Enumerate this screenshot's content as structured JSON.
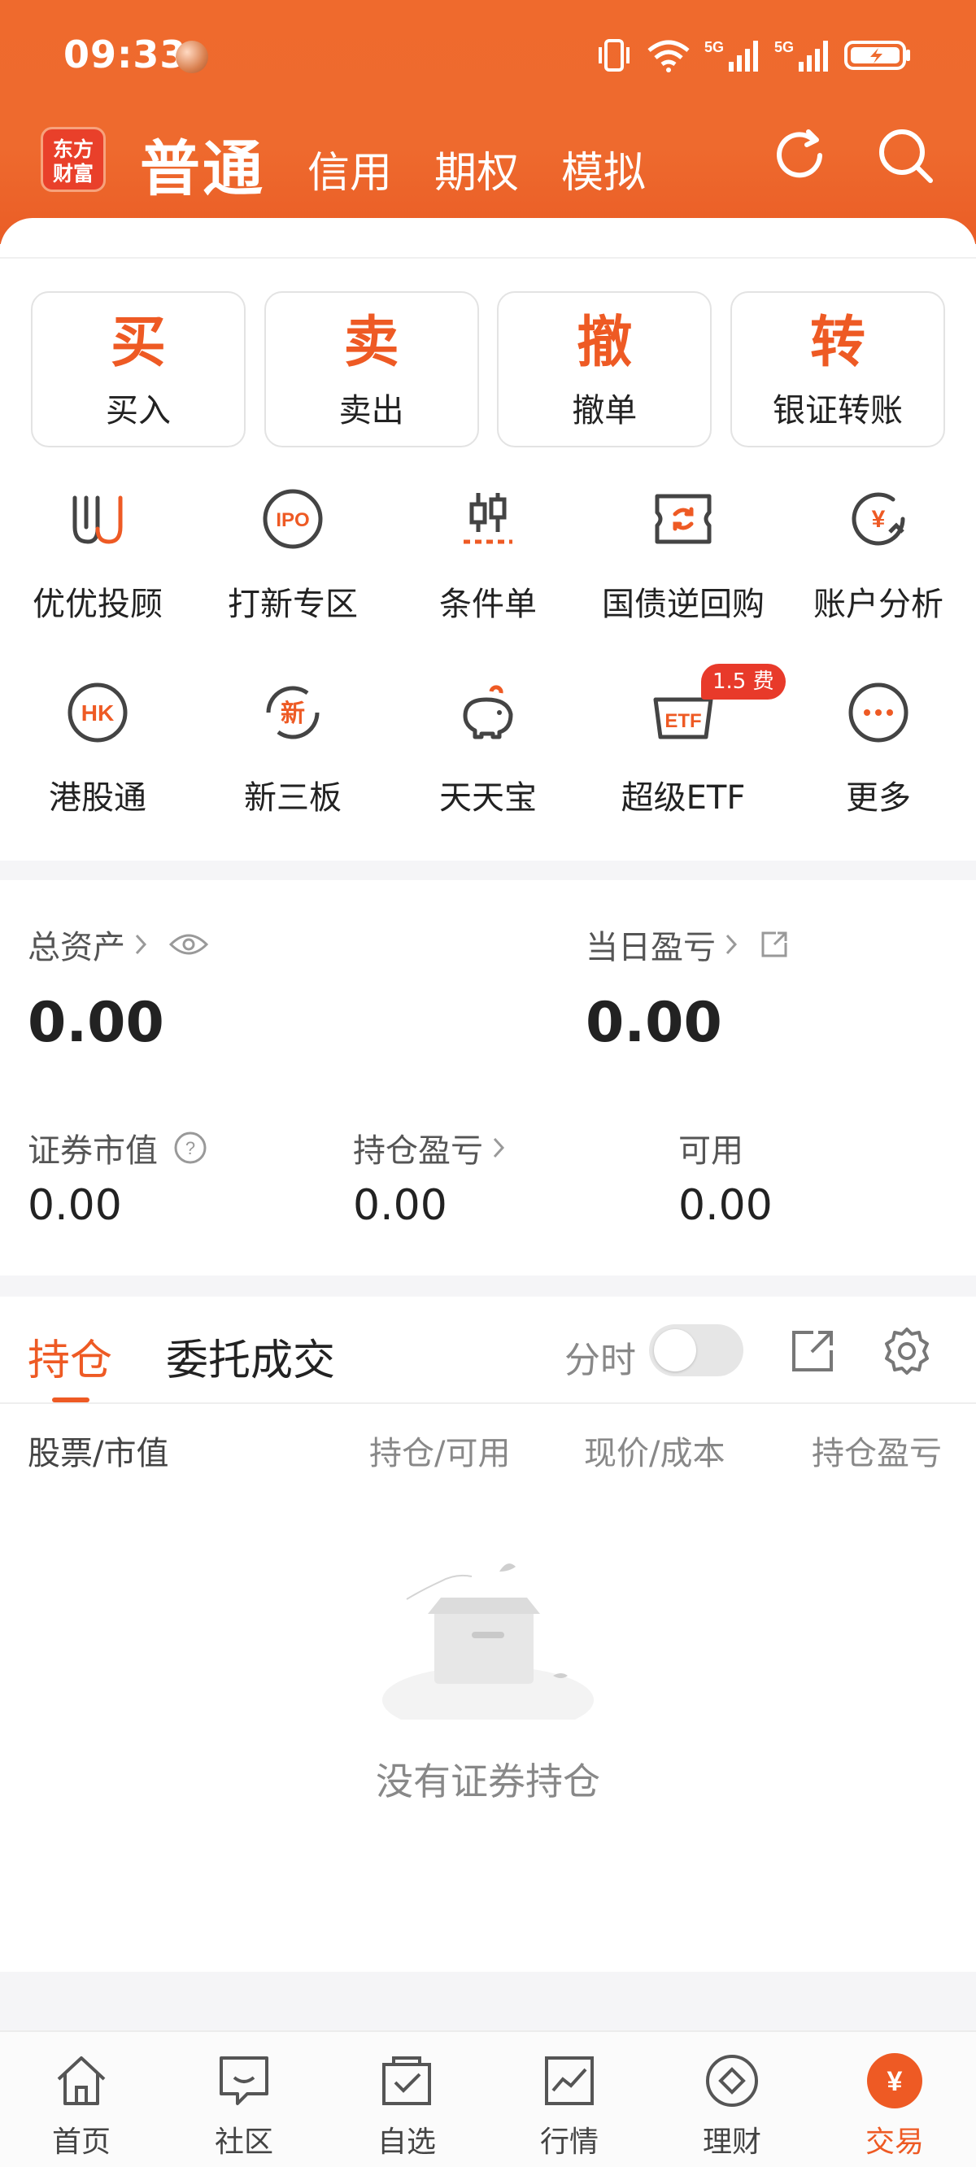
{
  "status_bar": {
    "time": "09:33",
    "network": "5G"
  },
  "header": {
    "logo_text": "东方\n财富",
    "logo_line1": "东方",
    "logo_line2": "财富",
    "tabs": [
      {
        "label": "普通",
        "active": true
      },
      {
        "label": "信用",
        "active": false
      },
      {
        "label": "期权",
        "active": false
      },
      {
        "label": "模拟",
        "active": false
      }
    ],
    "icons": [
      "refresh-icon",
      "search-icon"
    ]
  },
  "actions": [
    {
      "big": "买",
      "label": "买入"
    },
    {
      "big": "卖",
      "label": "卖出"
    },
    {
      "big": "撤",
      "label": "撤单"
    },
    {
      "big": "转",
      "label": "银证转账"
    }
  ],
  "grid": [
    {
      "label": "优优投顾",
      "icon": "advisor-icon"
    },
    {
      "label": "打新专区",
      "icon": "ipo-icon",
      "icon_text": "IPO"
    },
    {
      "label": "条件单",
      "icon": "condition-order-icon"
    },
    {
      "label": "国债逆回购",
      "icon": "reverse-repo-icon"
    },
    {
      "label": "账户分析",
      "icon": "account-analysis-icon",
      "icon_text": "¥"
    },
    {
      "label": "港股通",
      "icon": "hk-connect-icon",
      "icon_text": "HK"
    },
    {
      "label": "新三板",
      "icon": "new-third-board-icon",
      "icon_text": "新"
    },
    {
      "label": "天天宝",
      "icon": "piggy-bank-icon"
    },
    {
      "label": "超级ETF",
      "icon": "etf-icon",
      "icon_text": "ETF",
      "badge": "1.5 费"
    },
    {
      "label": "更多",
      "icon": "more-icon"
    }
  ],
  "assets": {
    "total_label": "总资产",
    "total_value": "0.00",
    "daily_pl_label": "当日盈亏",
    "daily_pl_value": "0.00",
    "market_value_label": "证券市值",
    "market_value": "0.00",
    "position_pl_label": "持仓盈亏",
    "position_pl": "0.00",
    "available_label": "可用",
    "available": "0.00"
  },
  "positions": {
    "tabs": [
      "持仓",
      "委托成交"
    ],
    "toggle_label": "分时",
    "toggle_on": false,
    "columns": [
      "股票/市值",
      "持仓/可用",
      "现价/成本",
      "持仓盈亏"
    ],
    "empty_text": "没有证券持仓"
  },
  "bottom_nav": [
    {
      "label": "首页",
      "icon": "home-icon",
      "active": false
    },
    {
      "label": "社区",
      "icon": "community-icon",
      "active": false
    },
    {
      "label": "自选",
      "icon": "watchlist-icon",
      "active": false
    },
    {
      "label": "行情",
      "icon": "market-icon",
      "active": false
    },
    {
      "label": "理财",
      "icon": "wealth-icon",
      "active": false
    },
    {
      "label": "交易",
      "icon": "trade-icon",
      "icon_text": "¥",
      "active": true
    }
  ],
  "colors": {
    "brand": "#ee5a24",
    "header": "#ef6a2d"
  }
}
